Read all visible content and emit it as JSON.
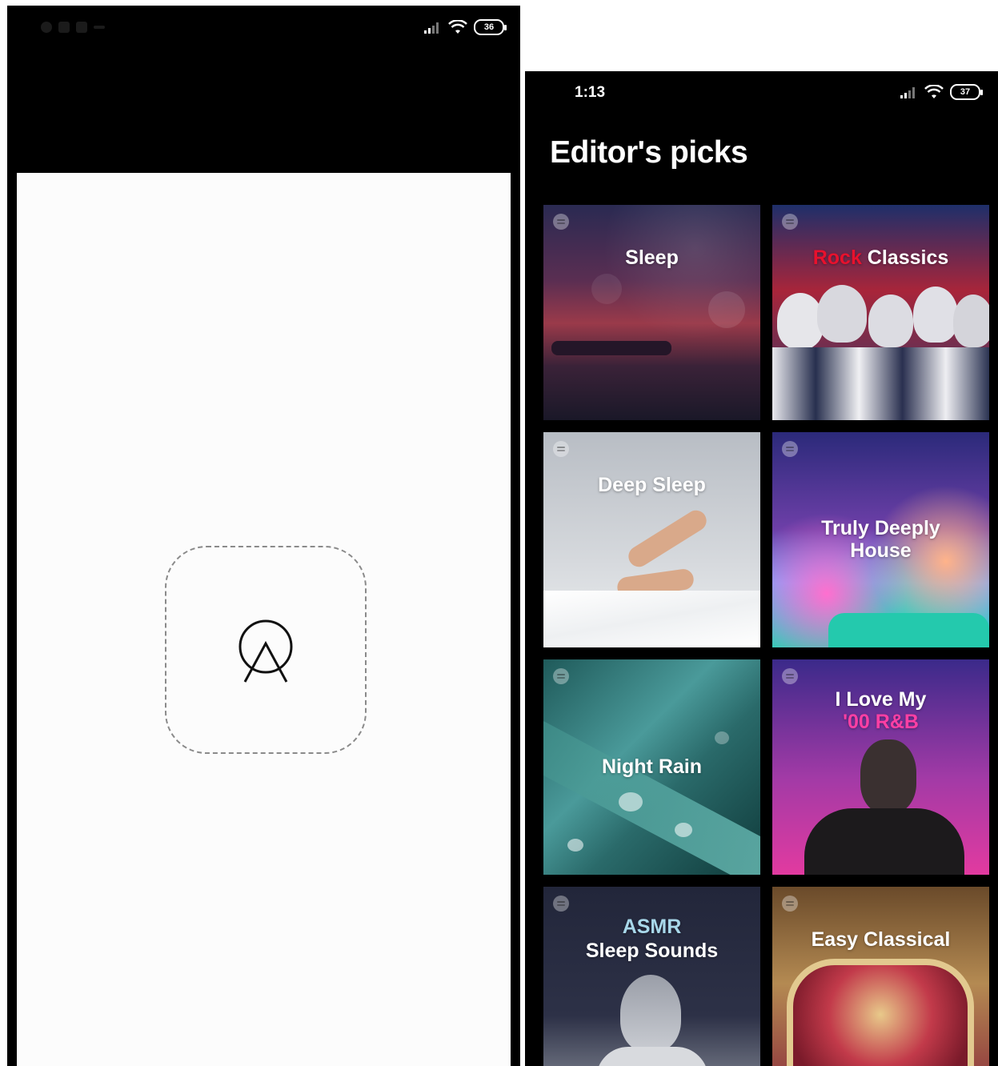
{
  "left_screen": {
    "battery_level": "36",
    "loading": true,
    "logo_icon": "circle-triangle-logo-icon"
  },
  "right_screen": {
    "status_bar": {
      "time": "1:13",
      "battery_level": "37"
    },
    "section_title": "Editor's picks",
    "playlists": [
      {
        "title": "Sleep"
      },
      {
        "title_accent": "Rock",
        "title_rest": " Classics",
        "accent_color": "#e8112d"
      },
      {
        "title": "Deep Sleep"
      },
      {
        "title_line1": "Truly Deeply",
        "title_line2": "House"
      },
      {
        "title": "Night Rain"
      },
      {
        "title_line1": "I Love My",
        "title_line2": "'00 R&B",
        "accent_color": "#ff3fa4"
      },
      {
        "title_line1": "ASMR",
        "title_line2": "Sleep Sounds",
        "accent_color": "#a8d8ea"
      },
      {
        "title": "Easy Classical"
      }
    ]
  }
}
